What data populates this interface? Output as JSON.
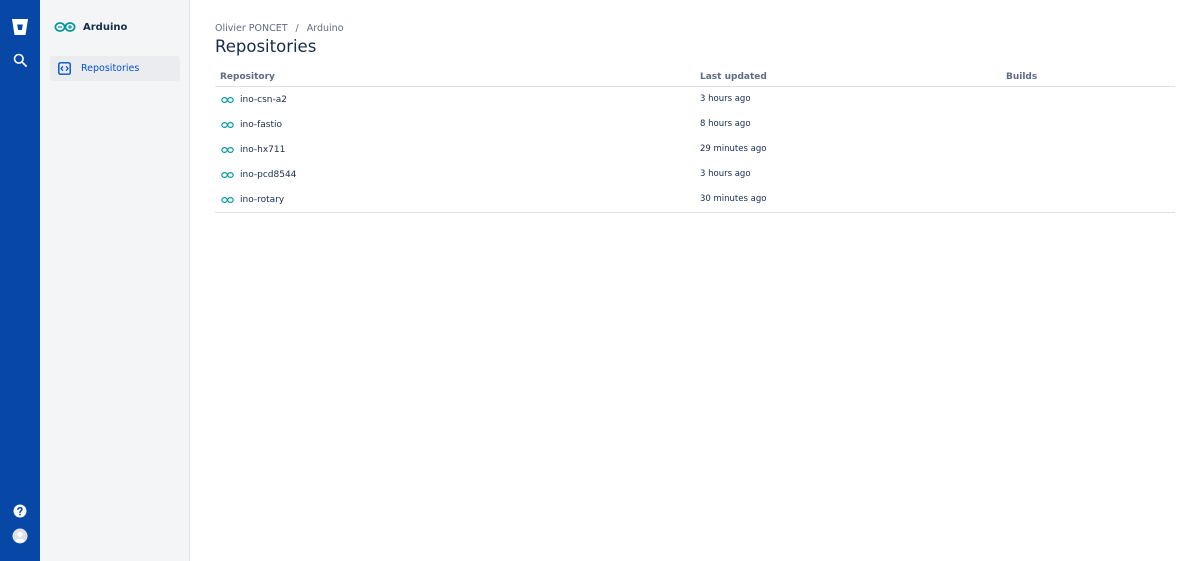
{
  "colors": {
    "global_nav_bg": "#0747a6",
    "sidebar_bg": "#f4f5f7",
    "accent_link": "#0052cc",
    "arduino_teal": "#00979d"
  },
  "global_nav": {
    "logo_icon": "bitbucket-logo-icon",
    "search_icon": "search-icon",
    "help_icon": "help-icon",
    "avatar_icon": "user-avatar-icon"
  },
  "sidebar": {
    "project_name": "Arduino",
    "items": [
      {
        "label": "Repositories",
        "icon": "code-icon"
      }
    ]
  },
  "breadcrumb": [
    {
      "label": "Olivier PONCET"
    },
    {
      "label": "Arduino"
    }
  ],
  "breadcrumb_separator": "/",
  "page_title": "Repositories",
  "table": {
    "columns": [
      "Repository",
      "Last updated",
      "Builds"
    ],
    "rows": [
      {
        "name": "ino-csn-a2",
        "updated": "3 hours ago"
      },
      {
        "name": "ino-fastio",
        "updated": "8 hours ago"
      },
      {
        "name": "ino-hx711",
        "updated": "29 minutes ago"
      },
      {
        "name": "ino-pcd8544",
        "updated": "3 hours ago"
      },
      {
        "name": "ino-rotary",
        "updated": "30 minutes ago"
      }
    ]
  }
}
